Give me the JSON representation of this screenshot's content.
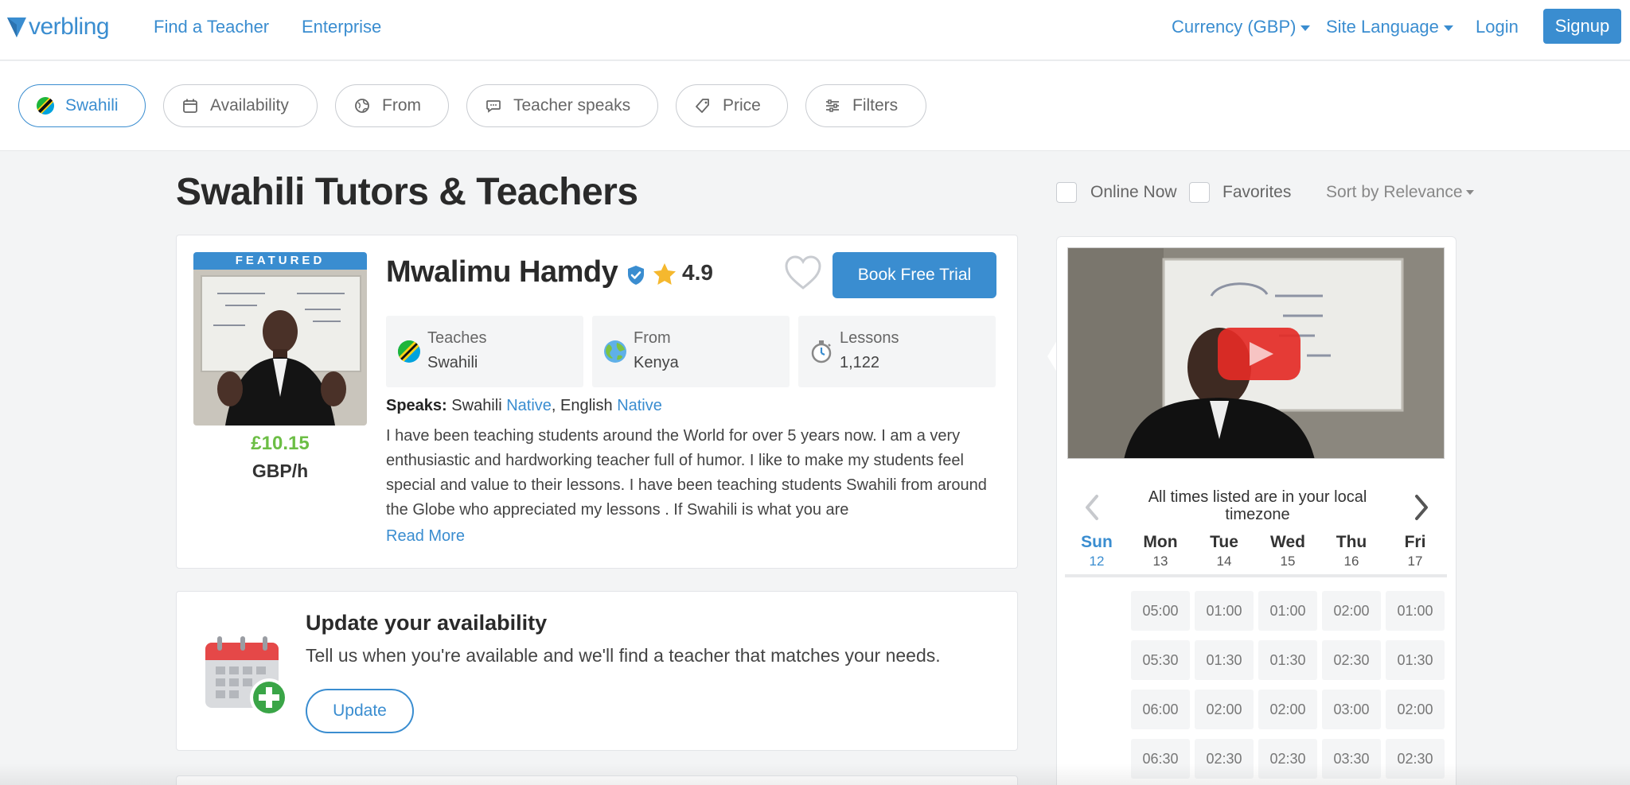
{
  "nav": {
    "logo_text": "verbling",
    "find_teacher": "Find a Teacher",
    "enterprise": "Enterprise",
    "currency": "Currency (GBP)",
    "site_language": "Site Language",
    "login": "Login",
    "signup": "Signup"
  },
  "filters": {
    "language": "Swahili",
    "availability": "Availability",
    "from": "From",
    "teacher_speaks": "Teacher speaks",
    "price": "Price",
    "filters": "Filters"
  },
  "page": {
    "title": "Swahili Tutors & Teachers",
    "online_now": "Online Now",
    "favorites": "Favorites",
    "sort": "Sort by Relevance"
  },
  "teacher": {
    "featured_label": "FEATURED",
    "name": "Mwalimu Hamdy",
    "rating": "4.9",
    "book_button": "Book Free Trial",
    "price": "£10.15",
    "price_unit": "GBP/h",
    "teaches_label": "Teaches",
    "teaches_value": "Swahili",
    "from_label": "From",
    "from_value": "Kenya",
    "lessons_label": "Lessons",
    "lessons_value": "1,122",
    "speaks_label": "Speaks:",
    "speaks_lang1": "Swahili",
    "speaks_level1": "Native",
    "speaks_sep": ", English",
    "speaks_level2": "Native",
    "bio": "I have been teaching students around the World for over 5 years now. I am a very enthusiastic and hardworking teacher full of humor. I like to make my students feel special and value to their lessons. I have been teaching students Swahili from around the Globe who appreciated my lessons . If Swahili is what you are",
    "read_more": "Read More"
  },
  "availability_card": {
    "title": "Update your availability",
    "text": "Tell us when you're available and we'll find a teacher that matches your needs.",
    "button": "Update"
  },
  "schedule": {
    "timezone_note": "All times listed are in your local timezone",
    "days": [
      {
        "name": "Sun",
        "date": "12",
        "today": true
      },
      {
        "name": "Mon",
        "date": "13"
      },
      {
        "name": "Tue",
        "date": "14"
      },
      {
        "name": "Wed",
        "date": "15"
      },
      {
        "name": "Thu",
        "date": "16"
      },
      {
        "name": "Fri",
        "date": "17"
      }
    ],
    "slots": [
      [
        "",
        "05:00",
        "01:00",
        "01:00",
        "02:00",
        "01:00"
      ],
      [
        "",
        "05:30",
        "01:30",
        "01:30",
        "02:30",
        "01:30"
      ],
      [
        "",
        "06:00",
        "02:00",
        "02:00",
        "03:00",
        "02:00"
      ],
      [
        "",
        "06:30",
        "02:30",
        "02:30",
        "03:30",
        "02:30"
      ]
    ]
  },
  "colors": {
    "brand_blue": "#3a8dd0",
    "price_green": "#6cbe45",
    "star_gold": "#f5b82e"
  }
}
